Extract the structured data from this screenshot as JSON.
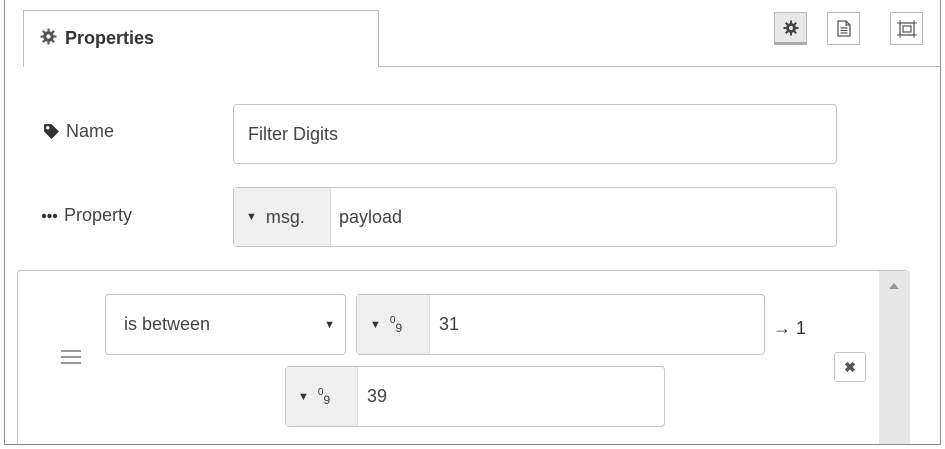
{
  "panel": {
    "tab_title": "Properties",
    "icons": {
      "tab": "gear-icon",
      "settings_button": "gear-icon",
      "description_button": "document-icon",
      "appearance_button": "frame-icon"
    }
  },
  "form": {
    "name": {
      "label": "Name",
      "icon": "tag-icon",
      "value": "Filter Digits"
    },
    "property": {
      "label": "Property",
      "icon": "ellipsis-icon",
      "type": "msg.",
      "value": "payload"
    }
  },
  "rules": [
    {
      "operator": "is between",
      "from": {
        "type_glyph": "0",
        "type_glyph_sub": "9",
        "value": "31"
      },
      "to": {
        "type_glyph": "0",
        "type_glyph_sub": "9",
        "value": "39"
      },
      "output": "→ 1",
      "delete": "✖"
    }
  ],
  "colors": {
    "border": "#c6c6c6",
    "type_bg": "#efefef",
    "scroll_track": "#e6e6e6"
  }
}
